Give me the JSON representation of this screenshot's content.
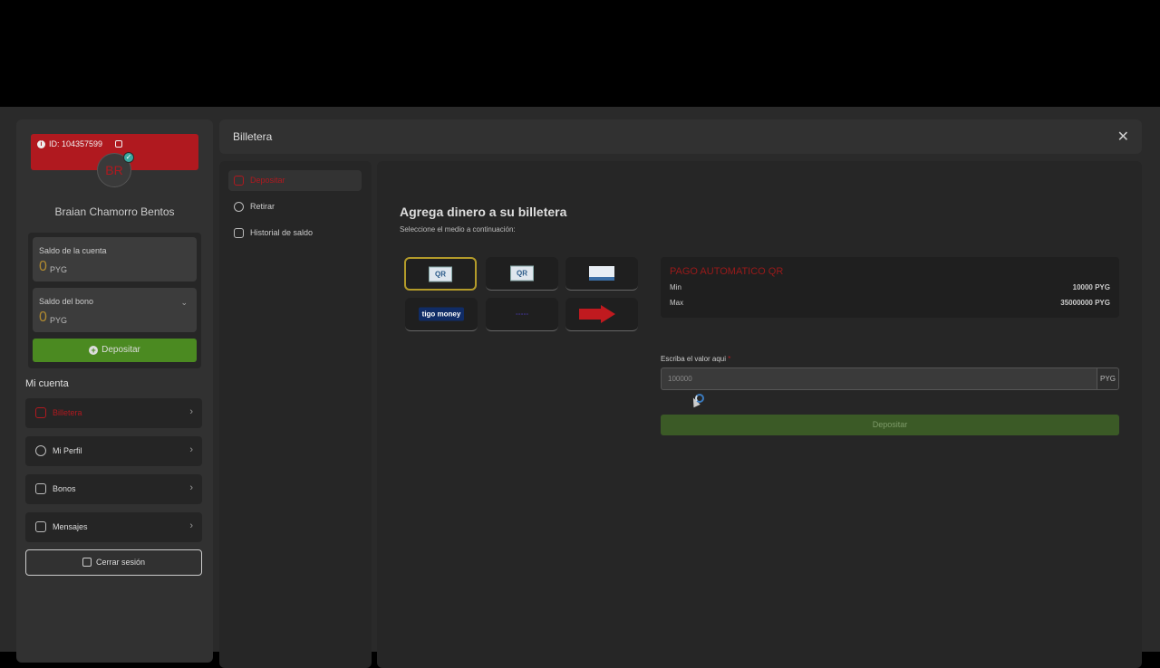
{
  "profile": {
    "id_text": "ID: 104357599",
    "avatar_initials": "BR",
    "name": "Braian Chamorro Bentos"
  },
  "balances": {
    "account_label": "Saldo de la cuenta",
    "account_amount": "0",
    "account_currency": "PYG",
    "bonus_label": "Saldo del bono",
    "bonus_amount": "0",
    "bonus_currency": "PYG",
    "deposit_button": "Depositar"
  },
  "account_menu": {
    "title": "Mi cuenta",
    "items": [
      {
        "label": "Billetera",
        "icon": "wallet-icon",
        "active": true
      },
      {
        "label": "Mi Perfil",
        "icon": "user-icon",
        "active": false
      },
      {
        "label": "Bonos",
        "icon": "gift-icon",
        "active": false
      },
      {
        "label": "Mensajes",
        "icon": "messages-icon",
        "active": false
      }
    ],
    "logout": "Cerrar sesión"
  },
  "modal": {
    "title": "Billetera",
    "close_icon": "close-icon"
  },
  "tabs": [
    {
      "label": "Depositar",
      "icon": "deposit-icon",
      "active": true
    },
    {
      "label": "Retirar",
      "icon": "withdraw-icon",
      "active": false
    },
    {
      "label": "Historial de saldo",
      "icon": "history-icon",
      "active": false
    }
  ],
  "deposit": {
    "heading": "Agrega dinero a su billetera",
    "subheading": "Seleccione el medio a continuación:",
    "methods": [
      {
        "logo": "qr-bank-logo",
        "selected": true
      },
      {
        "logo": "qr-bank-logo",
        "selected": false
      },
      {
        "logo": "bank-logo",
        "selected": false
      },
      {
        "logo": "tigo-money-logo",
        "text": "tigo money",
        "selected": false
      },
      {
        "logo": "pagoexpress-logo",
        "selected": false
      },
      {
        "logo": "red-arrow-logo",
        "selected": false
      }
    ],
    "info": {
      "title": "PAGO AUTOMATICO QR",
      "min_label": "Min",
      "min_value": "10000 PYG",
      "max_label": "Max",
      "max_value": "35000000 PYG"
    },
    "amount_label": "Escriba el valor aqui",
    "amount_required_mark": "*",
    "amount_placeholder": "100000",
    "amount_currency": "PYG",
    "submit_label": "Depositar"
  },
  "colors": {
    "accent_red": "#b0191f",
    "action_green": "#4b8a21",
    "selected_border": "#b39b2a"
  }
}
